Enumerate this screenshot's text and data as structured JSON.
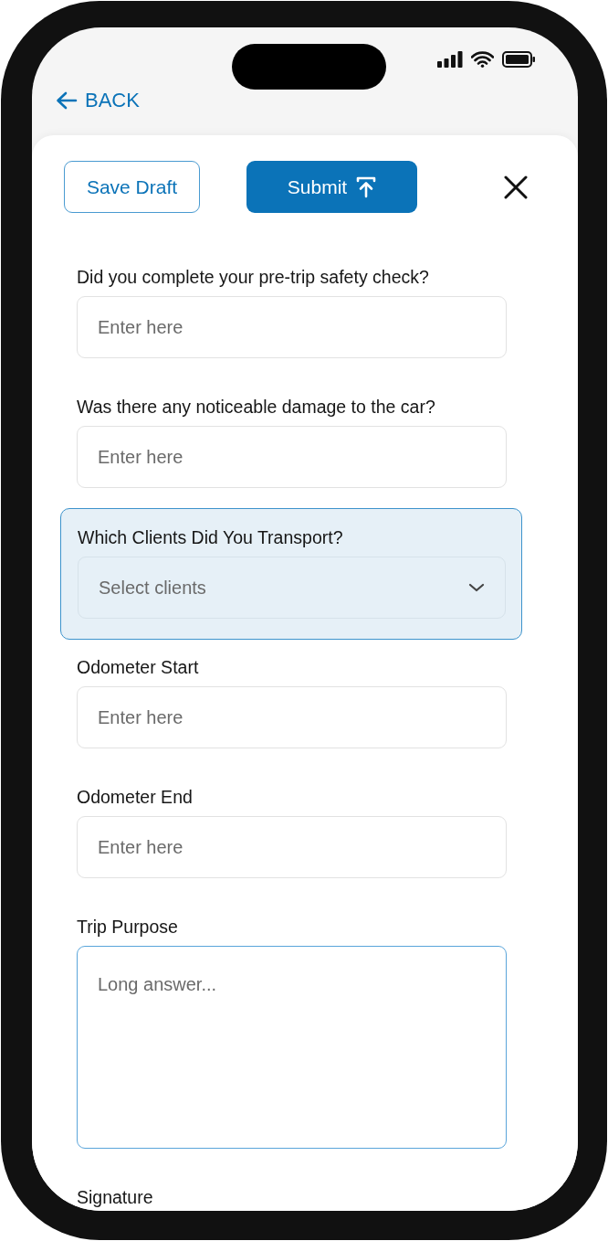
{
  "nav": {
    "back_label": "BACK"
  },
  "toolbar": {
    "save_draft": "Save Draft",
    "submit": "Submit"
  },
  "fields": [
    {
      "kind": "text",
      "label": "Did you complete your pre-trip safety check?",
      "placeholder": "Enter here",
      "highlighted": false
    },
    {
      "kind": "text",
      "label": "Was there any noticeable damage to the car?",
      "placeholder": "Enter here",
      "highlighted": false
    },
    {
      "kind": "select",
      "label": "Which Clients Did You Transport?",
      "placeholder": "Select clients",
      "highlighted": true
    },
    {
      "kind": "text",
      "label": "Odometer Start",
      "placeholder": "Enter here",
      "highlighted": false
    },
    {
      "kind": "text",
      "label": "Odometer End",
      "placeholder": "Enter here",
      "highlighted": false
    },
    {
      "kind": "textarea",
      "label": "Trip Purpose",
      "placeholder": "Long answer...",
      "highlighted": false
    },
    {
      "kind": "heading",
      "label": "Signature",
      "highlighted": false
    }
  ]
}
